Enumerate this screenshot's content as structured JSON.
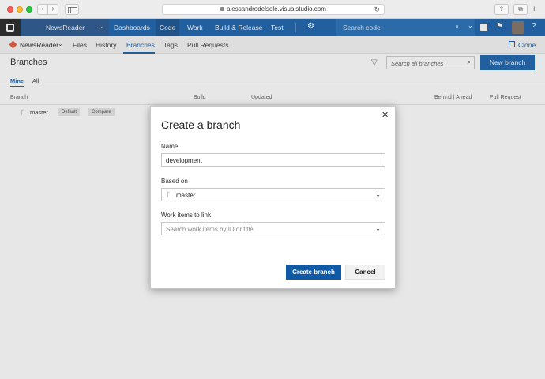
{
  "browser": {
    "url": "alessandrodelsole.visualstudio.com",
    "back_glyph": "‹",
    "forward_glyph": "›",
    "reload_glyph": "↻",
    "share_glyph": "⇪",
    "tabs_glyph": "⧉",
    "new_tab_glyph": "+"
  },
  "topnav": {
    "project": "NewsReader",
    "items": [
      "Dashboards",
      "Code",
      "Work",
      "Build & Release",
      "Test"
    ],
    "active_item": "Code",
    "search_placeholder": "Search code",
    "gear_glyph": "⚙",
    "search_glyph": "⌕",
    "chevron_glyph": "⌄",
    "flag_glyph": "⚑",
    "help_glyph": "?"
  },
  "subnav": {
    "repo": "NewsReader",
    "items": [
      "Files",
      "History",
      "Branches",
      "Tags",
      "Pull Requests"
    ],
    "active_item": "Branches",
    "clone_label": "Clone",
    "chevron_glyph": "⌄"
  },
  "page": {
    "title": "Branches",
    "search_placeholder": "Search all branches",
    "new_branch_label": "New branch",
    "filter_glyph": "▽",
    "search_glyph": "⌕",
    "pivots": [
      "Mine",
      "All"
    ],
    "active_pivot": "Mine",
    "columns": [
      "Branch",
      "Build",
      "Updated",
      "Behind | Ahead",
      "Pull Request"
    ],
    "rows": [
      {
        "name": "master",
        "tags": [
          "Default",
          "Compare"
        ]
      }
    ],
    "branch_glyph": "ᚴ"
  },
  "dialog": {
    "title": "Create a branch",
    "close_glyph": "✕",
    "name_label": "Name",
    "name_value": "development",
    "based_on_label": "Based on",
    "based_on_value": "master",
    "work_items_label": "Work items to link",
    "work_items_placeholder": "Search work items by ID or title",
    "create_label": "Create branch",
    "cancel_label": "Cancel",
    "chevron_glyph": "⌄"
  },
  "colors": {
    "accent": "#0f5aa6",
    "git_icon": "#e14f2f"
  }
}
